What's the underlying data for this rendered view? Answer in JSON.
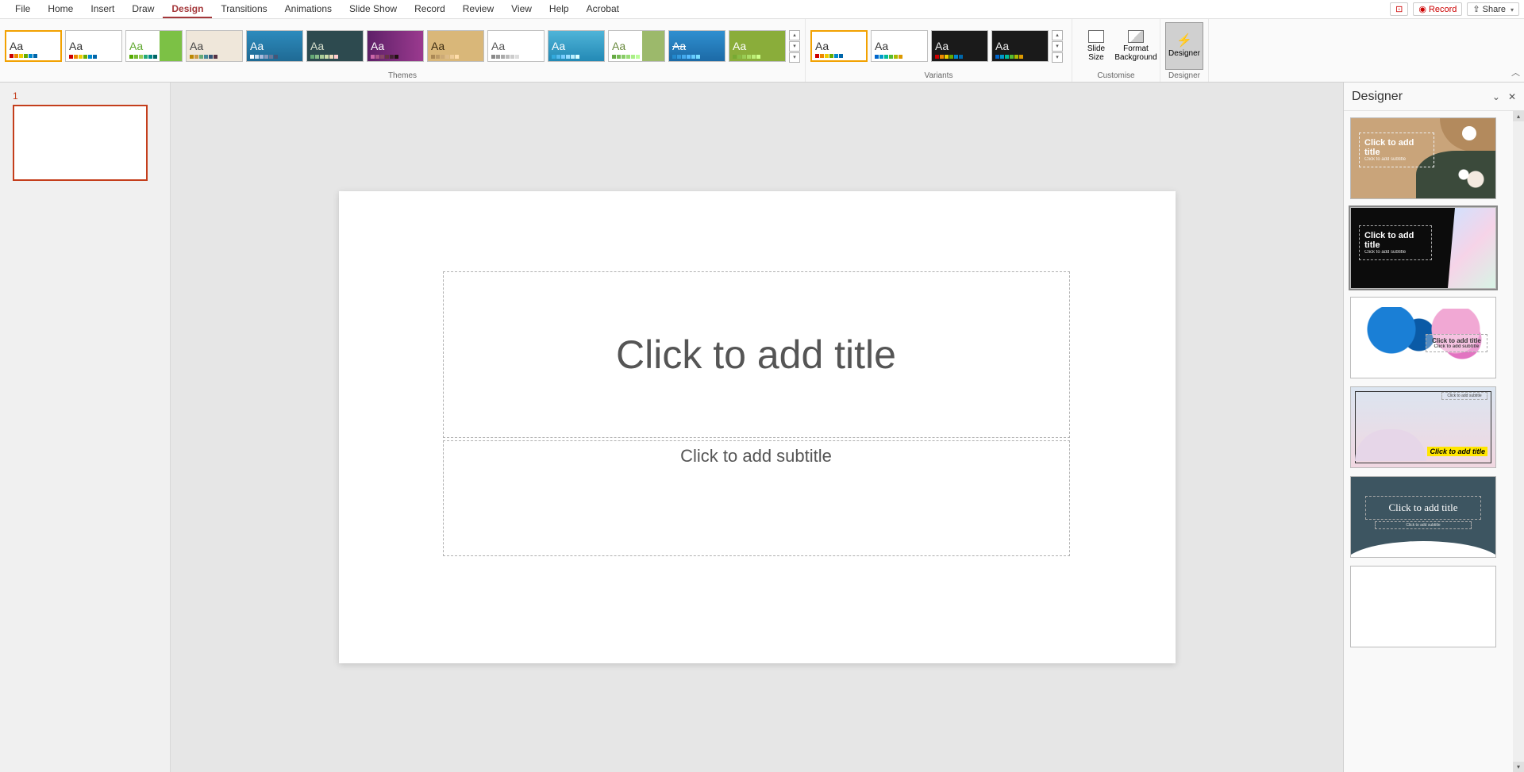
{
  "menu": {
    "items": [
      "File",
      "Home",
      "Insert",
      "Draw",
      "Design",
      "Transitions",
      "Animations",
      "Slide Show",
      "Record",
      "Review",
      "View",
      "Help",
      "Acrobat"
    ],
    "active": "Design",
    "right": {
      "comments": "💬",
      "record": "Record",
      "share": "Share"
    }
  },
  "ribbon": {
    "themes_label": "Themes",
    "variants_label": "Variants",
    "customise_label": "Customise",
    "designer_label": "Designer",
    "slide_size": "Slide\nSize",
    "format_bg": "Format\nBackground",
    "designer_btn": "Designer",
    "themes": [
      {
        "aa": "Aa",
        "bg": "#ffffff",
        "fg": "#333",
        "selected": true,
        "dots": [
          "#c00",
          "#e80",
          "#ec0",
          "#6a0",
          "#08c",
          "#06a"
        ]
      },
      {
        "aa": "Aa",
        "bg": "#ffffff",
        "fg": "#333",
        "dots": [
          "#c00",
          "#e80",
          "#ec0",
          "#6a0",
          "#08c",
          "#06a"
        ]
      },
      {
        "aa": "Aa",
        "bg": "linear-gradient(90deg,#fff 60%,#7cc145 60%)",
        "fg": "#5fa82e",
        "dots": [
          "#5a0",
          "#7b3",
          "#9c5",
          "#2a7",
          "#088",
          "#066"
        ]
      },
      {
        "aa": "Aa",
        "bg": "#efe7da",
        "fg": "#444",
        "dots": [
          "#b80",
          "#c94",
          "#6a7",
          "#489",
          "#357",
          "#534"
        ]
      },
      {
        "aa": "Aa",
        "bg": "linear-gradient(#2d8bbd,#1f6a94)",
        "fg": "#fff",
        "pattern": true,
        "dots": [
          "#fff",
          "#cde",
          "#abd",
          "#89b",
          "#679",
          "#457"
        ]
      },
      {
        "aa": "Aa",
        "bg": "#2d4a4f",
        "fg": "#d7e0cd",
        "dots": [
          "#6a7",
          "#8b8",
          "#ac9",
          "#cda",
          "#edb",
          "#fcc"
        ]
      },
      {
        "aa": "Aa",
        "bg": "linear-gradient(90deg,#5e2068,#9b3a8f)",
        "fg": "#fff",
        "dots": [
          "#c6a",
          "#a58",
          "#846",
          "#634",
          "#423",
          "#211"
        ]
      },
      {
        "aa": "Aa",
        "bg": "#d9b779",
        "fg": "#3a2a10",
        "dots": [
          "#a85",
          "#b96",
          "#ca7",
          "#db8",
          "#ec9",
          "#fda"
        ]
      },
      {
        "aa": "Aa",
        "bg": "#ffffff",
        "fg": "#555",
        "dots": [
          "#888",
          "#999",
          "#aaa",
          "#bbb",
          "#ccc",
          "#ddd"
        ]
      },
      {
        "aa": "Aa",
        "bg": "linear-gradient(#4fb4d8,#2389b5)",
        "fg": "#fff",
        "dots": [
          "#3ad",
          "#5be",
          "#7cf",
          "#9df",
          "#bef",
          "#dff"
        ]
      },
      {
        "aa": "Aa",
        "bg": "linear-gradient(90deg,#fff 60%,#9cb96b 60%)",
        "fg": "#6a8a3e",
        "dots": [
          "#6a4",
          "#7b5",
          "#8c6",
          "#9d7",
          "#ae8",
          "#bf9"
        ]
      },
      {
        "aa": "Aa",
        "bg": "linear-gradient(#2f8fd0,#1c6aa6)",
        "fg": "#fff",
        "strike": true,
        "dots": [
          "#28c",
          "#39d",
          "#4ae",
          "#5bf",
          "#6cf",
          "#7df"
        ]
      },
      {
        "aa": "Aa",
        "bg": "#8aad3a",
        "fg": "#fff",
        "dots": [
          "#7a3",
          "#8b4",
          "#9c5",
          "#ad6",
          "#be7",
          "#cf8"
        ]
      }
    ],
    "variants": [
      {
        "bg": "#ffffff",
        "fg": "#333",
        "selected": true,
        "dots": [
          "#c00",
          "#e80",
          "#ec0",
          "#6a0",
          "#08c",
          "#06a"
        ]
      },
      {
        "bg": "#ffffff",
        "fg": "#333",
        "dots": [
          "#06c",
          "#09c",
          "#0b9",
          "#5b3",
          "#ab0",
          "#d90"
        ]
      },
      {
        "bg": "#1a1a1a",
        "fg": "#eee",
        "dots": [
          "#c00",
          "#e80",
          "#ec0",
          "#6a0",
          "#08c",
          "#06a"
        ]
      },
      {
        "bg": "#1a1a1a",
        "fg": "#eee",
        "dots": [
          "#06c",
          "#09c",
          "#0b9",
          "#5b3",
          "#ab0",
          "#d90"
        ]
      }
    ]
  },
  "slides": {
    "current": "1"
  },
  "canvas": {
    "title_ph": "Click to add title",
    "subtitle_ph": "Click to add subtitle"
  },
  "designer": {
    "title": "Designer",
    "cards": [
      {
        "title": "Click to add title",
        "sub": "Click to add subtitle"
      },
      {
        "title": "Click to add title",
        "sub": "Click to add subtitle"
      },
      {
        "title": "Click to add title",
        "sub": "Click to add subtitle"
      },
      {
        "title": "Click to add title",
        "sub": "Click to add subtitle"
      },
      {
        "title": "Click to add title",
        "sub": "Click to add subtitle"
      },
      {
        "title": "",
        "sub": ""
      }
    ]
  }
}
